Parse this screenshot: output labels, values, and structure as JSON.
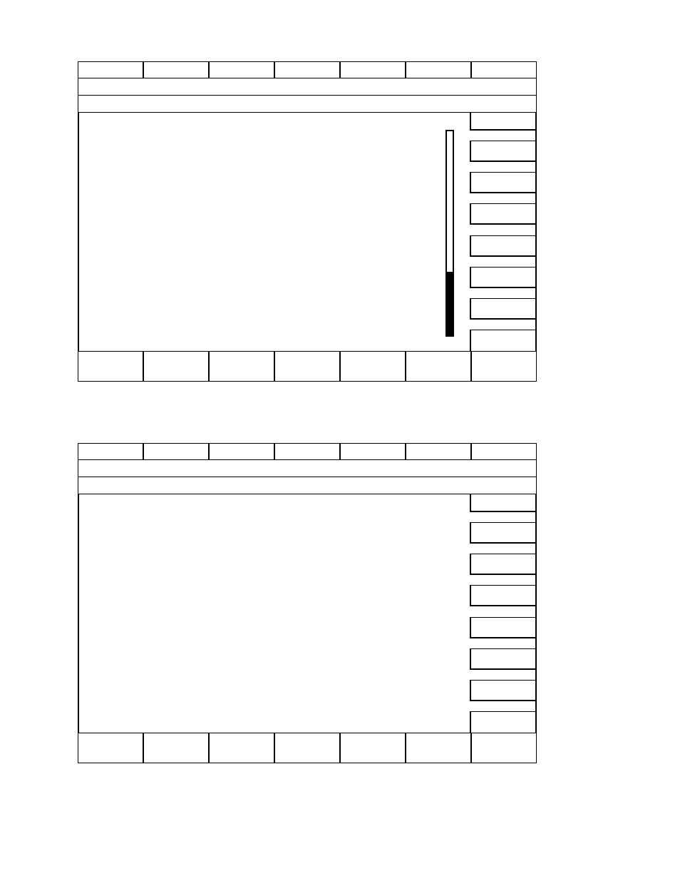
{
  "screens": [
    {
      "kind": "metered",
      "meter": {
        "level": 0.31
      }
    },
    {
      "kind": "plain"
    }
  ]
}
